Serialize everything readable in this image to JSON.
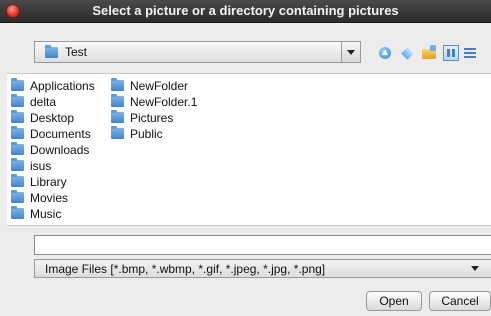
{
  "window": {
    "title": "Select a picture or a directory containing pictures"
  },
  "directory_combo": {
    "value": "Test",
    "icon": "folder-icon"
  },
  "toolbar": {
    "icons": [
      "up-one-level-icon",
      "home-icon",
      "new-folder-icon",
      "list-view-icon",
      "details-view-icon"
    ]
  },
  "file_list": {
    "column1": [
      "Applications",
      "delta",
      "Desktop",
      "Documents",
      "Downloads",
      "isus",
      "Library",
      "Movies",
      "Music"
    ],
    "column2": [
      "NewFolder",
      "NewFolder.1",
      "Pictures",
      "Public"
    ]
  },
  "file_name_field": {
    "value": ""
  },
  "filter_combo": {
    "value": "Image Files [*.bmp, *.wbmp, *.gif, *.jpeg, *.jpg, *.png]"
  },
  "buttons": {
    "open": "Open",
    "cancel": "Cancel"
  },
  "colors": {
    "folder": "#3f86cc",
    "titlebar": "#2b2b2b",
    "close": "#e0392b"
  }
}
